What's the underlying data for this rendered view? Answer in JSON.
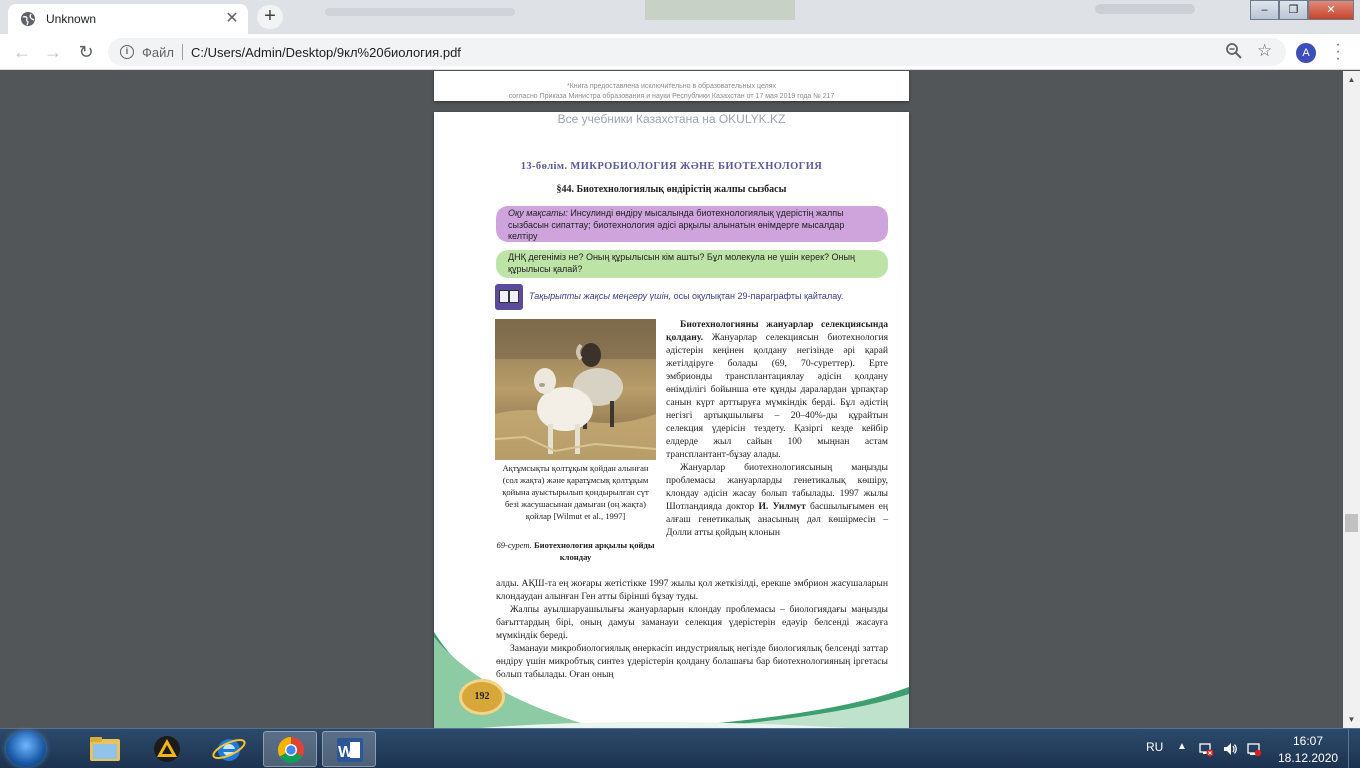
{
  "browser": {
    "tab_title": "Unknown",
    "tab_close": "✕",
    "new_tab": "+",
    "address_scheme": "Файл",
    "address_url": "C:/Users/Admin/Desktop/9кл%20биология.pdf",
    "profile_initial": "A"
  },
  "window_controls": {
    "minimize": "–",
    "maximize": "❐",
    "close": "✕"
  },
  "pdf": {
    "prev_page_note_line1": "*Книга предоставлена исключительно в образовательных целях",
    "prev_page_note_line2": "согласно Приказа Министра образования и науки Республики Казахстан от 17 мая 2019 года № 217",
    "watermark": "Все учебники Казахстана на OKULYK.KZ",
    "section_title": "13-бөлім. МИКРОБИОЛОГИЯ ЖӘНЕ БИОТЕХНОЛОГИЯ",
    "paragraph_title": "§44. Биотехнологиялық өндірістің жалпы сызбасы",
    "goal_label": "Оқу мақсаты:",
    "goal_text": "Инсулинді өндіру мысалында биотехнологиялық үдерістің жалпы сызбасын сипаттау; биотехнология әдісі арқылы алынатын өнімдерге мысалдар келтіру",
    "questions": "ДНҚ дегеніміз не? Оның құрылысын кім ашты? Бұл молекула не үшін керек? Оның құрылысы қалай?",
    "tip_italic": "Тақырыпты жақсы меңгеру үшін,",
    "tip_text": "осы оқулықтан 29-параграфты қайталау.",
    "photo_caption": "Ақтұмсықты қолтұқым қойдан алынған (сол жақта) және қаратұмсық қолтұқым қойына ауыстырылып қондырылған сүт безі жасушасынан дамыған (оң жақта) қойлар [Wilmut et al., 1997]",
    "figure_number": "69-сурет.",
    "figure_title": "Биотехнология арқылы қойды клондау",
    "p1_bold": "Биотехнологияны жануарлар селекциясында қолдану.",
    "p1_text": "Жануарлар селекциясын биотехнология әдістерін кеңінен қолдану негізінде әрі қарай жетілдіруге болады (69, 70-суреттер). Ерте эмбрионды трансплантациялау әдісін қолдану өнімділігі бойынша өте құнды даралардан ұрпақтар санын күрт арттыруға мүмкіндік берді. Бұл әдістің негізгі артықшылығы – 20–40%-ды құрайтын селекция үдерісін тездету. Қазіргі кезде кейбір елдерде жыл сайын 100 мыңнан астам трансплантант-бұзау алады.",
    "p2_start": "Жануарлар биотехнологиясының маңызды проблемасы жануарларды генетикалық көшіру, клондау әдісін жасау болып табылады. 1997 жылы Шотландияда доктор",
    "p2_bold": "И. Уилмут",
    "p2_end": "басшылығымен ең алғаш генетикалық анасының дәл көшірмесін – Долли атты қойдың клонын",
    "p2_continued": "алды. АҚШ-та ең жоғары жетістікке 1997 жылы қол жеткізілді, ерекше эмбрион жасушаларын клондаудан алынған Ген атты бірінші бұзау туды.",
    "p3": "Жалпы ауылшаруашылығы жануарларын клондау проблемасы – биологиядағы маңызды бағыттардың бірі, оның дамуы заманауи селекция үдерістерін едәуір белсенді жасауға мүмкіндік береді.",
    "p4": "Заманауи микробиологиялық өнеркәсіп индустриялық негізде биологиялық белсенді заттар өндіру үшін микробтық синтез үдерістерін қолдану болашағы бар биотехнологияның іргетасы болып табылады. Оған оның",
    "page_number": "192"
  },
  "taskbar": {
    "language": "RU",
    "time": "16:07",
    "date": "18.12.2020",
    "apps": [
      "explorer-icon",
      "archiver-icon",
      "ie-icon",
      "chrome-icon",
      "word-icon"
    ]
  },
  "colors": {
    "accent_purple": "#cfa4dc",
    "accent_green": "#bde3a6",
    "section_blue": "#5a5a9a",
    "page_badge": "#d7a73a"
  }
}
